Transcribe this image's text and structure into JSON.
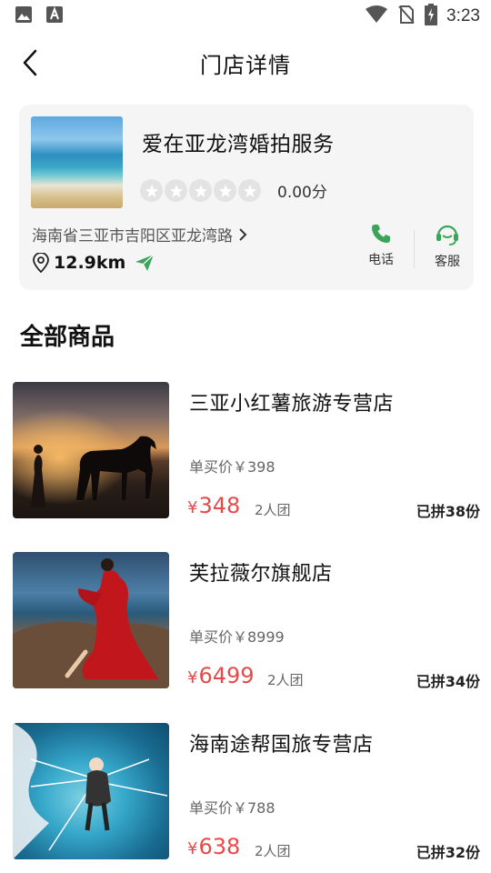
{
  "status_bar": {
    "time": "3:23"
  },
  "nav": {
    "title": "门店详情"
  },
  "store": {
    "name": "爱在亚龙湾婚拍服务",
    "score": "0.00分",
    "address": "海南省三亚市吉阳区亚龙湾路",
    "distance": "12.9km",
    "phone_label": "电话",
    "service_label": "客服"
  },
  "section": {
    "title": "全部商品"
  },
  "products": [
    {
      "name": "三亚小红薯旅游专营店",
      "single_price": "单买价￥398",
      "currency": "¥",
      "group_price": "348",
      "group_size": "2人团",
      "sold": "已拼38份"
    },
    {
      "name": "芙拉薇尔旗舰店",
      "single_price": "单买价￥8999",
      "currency": "¥",
      "group_price": "6499",
      "group_size": "2人团",
      "sold": "已拼34份"
    },
    {
      "name": "海南途帮国旅专营店",
      "single_price": "单买价￥788",
      "currency": "¥",
      "group_price": "638",
      "group_size": "2人团",
      "sold": "已拼32份"
    }
  ],
  "colors": {
    "accent_red": "#e84a4a",
    "accent_green": "#3aa55a",
    "card_bg": "#f5f5f5"
  },
  "icons": {
    "status_left": [
      "image-icon",
      "text-icon"
    ],
    "status_right": [
      "wifi-icon",
      "no-sim-icon",
      "battery-charging-icon"
    ],
    "store": [
      "location-pin-icon",
      "send-icon",
      "phone-icon",
      "headset-icon",
      "chevron-right-icon"
    ],
    "nav": [
      "back-arrow-icon"
    ]
  }
}
